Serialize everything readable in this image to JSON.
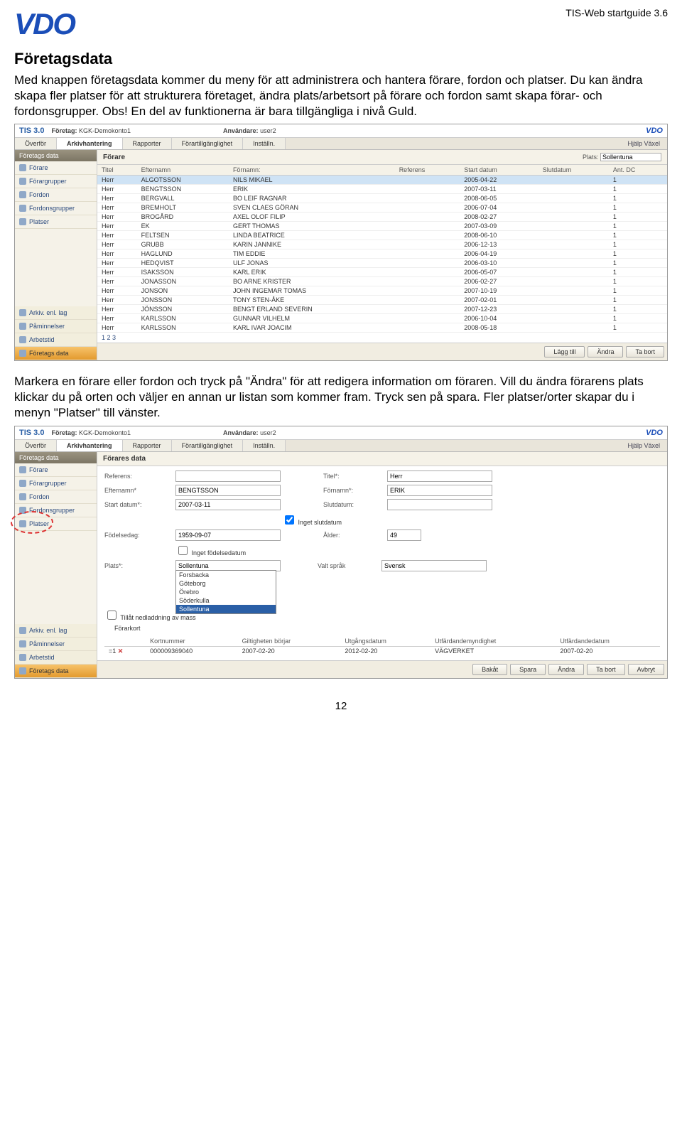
{
  "doc_header": "TIS-Web startguide 3.6",
  "logo": "VDO",
  "title": "Företagsdata",
  "para1": "Med knappen företagsdata kommer du meny för att administrera och hantera förare, fordon och platser. Du kan ändra skapa fler platser för att strukturera företaget, ändra plats/arbetsort på förare och fordon samt skapa förar- och fordonsgrupper. Obs! En del av funktionerna är bara tillgängliga i nivå Guld.",
  "para2": "Markera en förare eller fordon och tryck på \"Ändra\" för att redigera information om föraren. Vill du ändra förarens plats klickar du på orten och väljer en annan ur listan som kommer fram. Tryck sen på spara. Fler platser/orter skapar du i menyn \"Platser\" till vänster.",
  "page_number": "12",
  "app": {
    "tis": "TIS 3.0",
    "company_label": "Företag:",
    "company": "KGK-Demokonto1",
    "user_label": "Användare:",
    "user": "user2",
    "brand": "VDO",
    "tabs": [
      "Överför",
      "Arkivhantering",
      "Rapporter",
      "Förartillgänglighet",
      "Inställn."
    ],
    "right_links": "Hjälp    Växel",
    "sidebar_title": "Företags data",
    "sidebar_items": [
      "Förare",
      "Förargrupper",
      "Fordon",
      "Fordonsgrupper",
      "Platser"
    ],
    "sidebar_bottom": [
      "Arkiv. enl. lag",
      "Påminnelser",
      "Arbetstid",
      "Företags data"
    ]
  },
  "screen1": {
    "main_title": "Förare",
    "plats_label": "Plats:",
    "plats_value": "Sollentuna",
    "columns": [
      "Titel",
      "Efternamn",
      "Förnamn:",
      "Referens",
      "Start datum",
      "Slutdatum",
      "Ant. DC"
    ],
    "rows": [
      [
        "Herr",
        "ALGOTSSON",
        "NILS MIKAEL",
        "",
        "2005-04-22",
        "",
        "1"
      ],
      [
        "Herr",
        "BENGTSSON",
        "ERIK",
        "",
        "2007-03-11",
        "",
        "1"
      ],
      [
        "Herr",
        "BERGVALL",
        "BO LEIF RAGNAR",
        "",
        "2008-06-05",
        "",
        "1"
      ],
      [
        "Herr",
        "BREMHOLT",
        "SVEN CLAES GÖRAN",
        "",
        "2006-07-04",
        "",
        "1"
      ],
      [
        "Herr",
        "BROGÅRD",
        "AXEL OLOF FILIP",
        "",
        "2008-02-27",
        "",
        "1"
      ],
      [
        "Herr",
        "EK",
        "GERT THOMAS",
        "",
        "2007-03-09",
        "",
        "1"
      ],
      [
        "Herr",
        "FELTSEN",
        "LINDA BEATRICE",
        "",
        "2008-06-10",
        "",
        "1"
      ],
      [
        "Herr",
        "GRUBB",
        "KARIN JANNIKE",
        "",
        "2006-12-13",
        "",
        "1"
      ],
      [
        "Herr",
        "HAGLUND",
        "TIM EDDIE",
        "",
        "2006-04-19",
        "",
        "1"
      ],
      [
        "Herr",
        "HEDQVIST",
        "ULF JONAS",
        "",
        "2006-03-10",
        "",
        "1"
      ],
      [
        "Herr",
        "ISAKSSON",
        "KARL ERIK",
        "",
        "2006-05-07",
        "",
        "1"
      ],
      [
        "Herr",
        "JONASSON",
        "BO ARNE KRISTER",
        "",
        "2006-02-27",
        "",
        "1"
      ],
      [
        "Herr",
        "JONSON",
        "JOHN INGEMAR TOMAS",
        "",
        "2007-10-19",
        "",
        "1"
      ],
      [
        "Herr",
        "JONSSON",
        "TONY STEN-ÅKE",
        "",
        "2007-02-01",
        "",
        "1"
      ],
      [
        "Herr",
        "JÖNSSON",
        "BENGT ERLAND SEVERIN",
        "",
        "2007-12-23",
        "",
        "1"
      ],
      [
        "Herr",
        "KARLSSON",
        "GUNNAR VILHELM",
        "",
        "2006-10-04",
        "",
        "1"
      ],
      [
        "Herr",
        "KARLSSON",
        "KARL IVAR JOACIM",
        "",
        "2008-05-18",
        "",
        "1"
      ]
    ],
    "pager": "1 2 3",
    "buttons": [
      "Lägg till",
      "Ändra",
      "Ta bort"
    ]
  },
  "screen2": {
    "main_title": "Förares data",
    "fields": {
      "referens": "Referens:",
      "titel": "Titel*:",
      "titel_v": "Herr",
      "efternamn": "Efternamn*",
      "efternamn_v": "BENGTSSON",
      "fornamn": "Förnamn*:",
      "fornamn_v": "ERIK",
      "start": "Start datum*:",
      "start_v": "2007-03-11",
      "slut": "Slutdatum:",
      "chk_noend": "Inget slutdatum",
      "fodelse": "Födelsedag:",
      "fodelse_v": "1959-09-07",
      "alder": "Ålder:",
      "alder_v": "49",
      "chk_nobirth": "Inget födelsedatum",
      "plats": "Plats*:",
      "plats_v": "Sollentuna",
      "sprak": "Valt språk",
      "sprak_v": "Svensk",
      "dd_options": [
        "Forsbacka",
        "Göteborg",
        "Örebro",
        "Söderkulla",
        "Sollentuna"
      ],
      "allow_line": "Tillåt nedladdning av mass",
      "allow_sub": "Förarkort",
      "cardcols": [
        "",
        "Kortnummer",
        "Giltigheten börjar",
        "Utgångsdatum",
        "Utfärdandemyndighet",
        "Utfärdandedatum"
      ],
      "cardrow": [
        "=1",
        "000009369040",
        "2007-02-20",
        "2012-02-20",
        "VÄGVERKET",
        "2007-02-20"
      ]
    },
    "buttons": [
      "Bakåt",
      "Spara",
      "Ändra",
      "Ta bort",
      "Avbryt"
    ]
  }
}
